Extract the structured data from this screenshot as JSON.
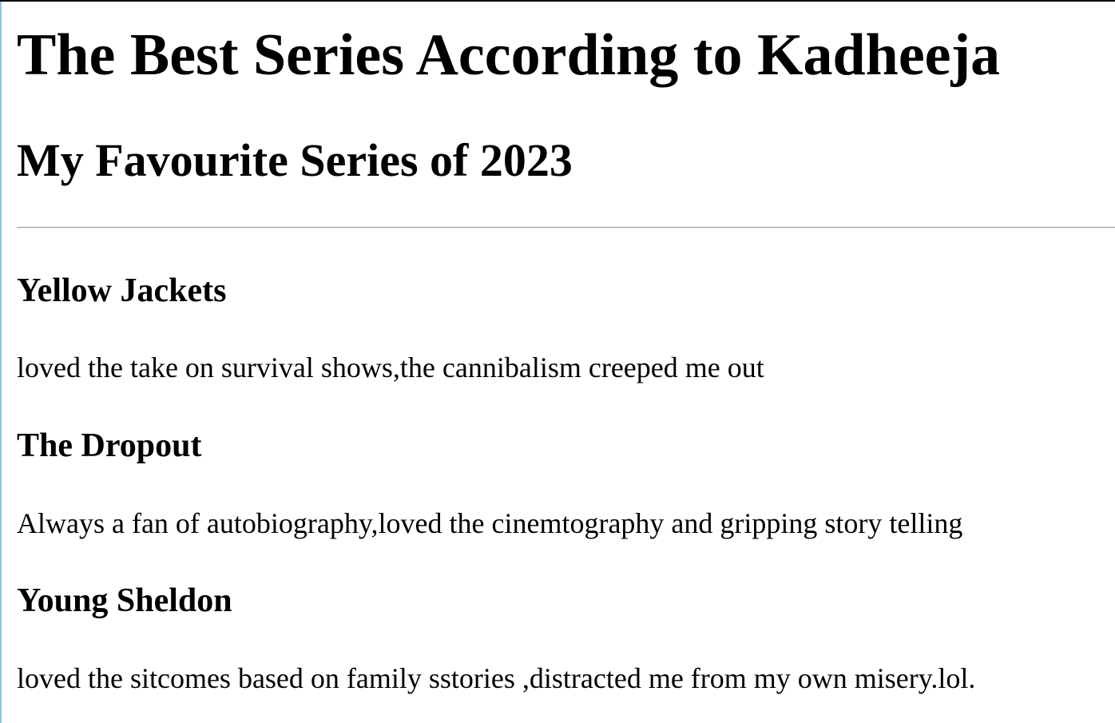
{
  "page": {
    "title": "The Best Series According to Kadheeja",
    "subtitle": "My Favourite Series of 2023"
  },
  "series": [
    {
      "title": "Yellow Jackets",
      "review": "loved the take on survival shows,the cannibalism creeped me out"
    },
    {
      "title": "The Dropout",
      "review": "Always a fan of autobiography,loved the cinemtography and gripping story telling"
    },
    {
      "title": "Young Sheldon",
      "review": "loved the sitcomes based on family sstories ,distracted me from my own misery.lol."
    }
  ]
}
